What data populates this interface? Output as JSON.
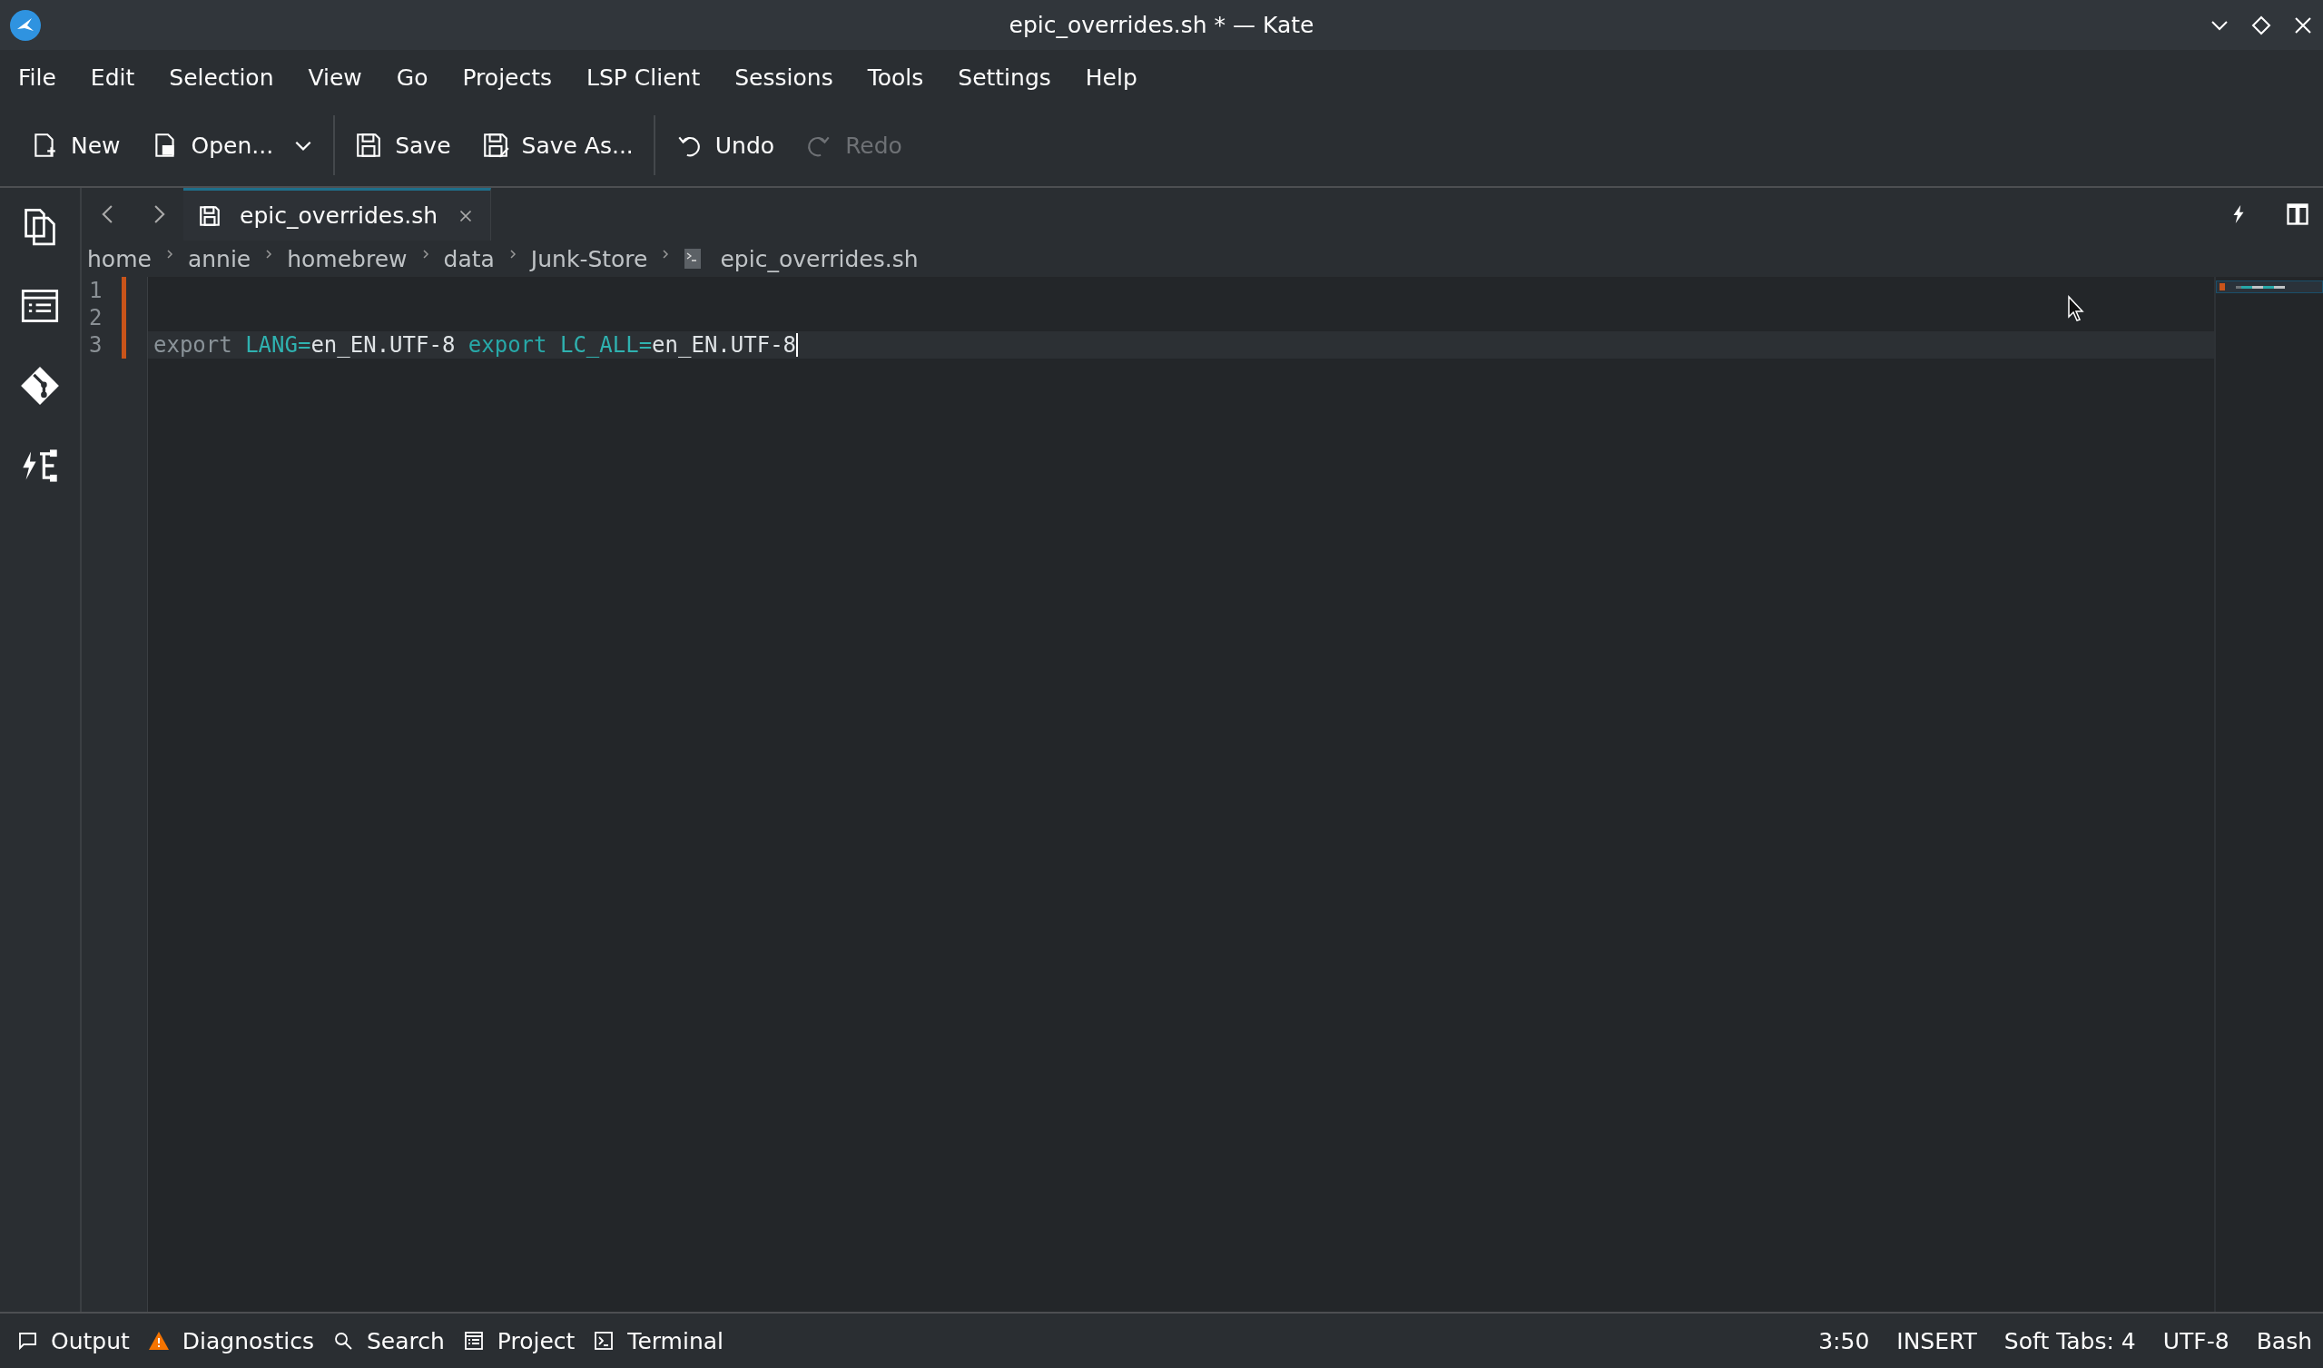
{
  "window": {
    "title": "epic_overrides.sh * — Kate"
  },
  "menu": [
    "File",
    "Edit",
    "Selection",
    "View",
    "Go",
    "Projects",
    "LSP Client",
    "Sessions",
    "Tools",
    "Settings",
    "Help"
  ],
  "toolbar": [
    {
      "kind": "new",
      "label": "New",
      "disabled": false
    },
    {
      "kind": "open",
      "label": "Open...",
      "disabled": false
    },
    {
      "kind": "save",
      "label": "Save",
      "disabled": false
    },
    {
      "kind": "saveas",
      "label": "Save As...",
      "disabled": false
    },
    {
      "kind": "undo",
      "label": "Undo",
      "disabled": false
    },
    {
      "kind": "redo",
      "label": "Redo",
      "disabled": true
    }
  ],
  "tabs": [
    {
      "label": "epic_overrides.sh",
      "selected": true
    }
  ],
  "breadcrumb": [
    "home",
    "annie",
    "homebrew",
    "data",
    "Junk-Store",
    "epic_overrides.sh"
  ],
  "lines": [
    {
      "number": "1",
      "modified": true,
      "current": false
    },
    {
      "number": "2",
      "modified": true,
      "current": false
    },
    {
      "number": "3",
      "modified": true,
      "current": true,
      "tokens": [
        {
          "kind": "keyword",
          "text": "export "
        },
        {
          "kind": "variable",
          "text": "LANG="
        },
        {
          "kind": "plain",
          "text": "en_EN.UTF-8 "
        },
        {
          "kind": "builtin",
          "text": "export "
        },
        {
          "kind": "variable",
          "text": "LC_ALL="
        },
        {
          "kind": "plain",
          "text": "en_EN.UTF-8"
        }
      ]
    }
  ],
  "bottom_tabs": [
    {
      "kind": "output",
      "label": "Output"
    },
    {
      "kind": "diagnostics",
      "label": "Diagnostics"
    },
    {
      "kind": "search",
      "label": "Search"
    },
    {
      "kind": "project",
      "label": "Project"
    },
    {
      "kind": "terminal",
      "label": "Terminal"
    }
  ],
  "status_bar": [
    "3:50",
    "INSERT",
    "Soft Tabs: 4",
    "UTF-8",
    "Bash"
  ]
}
